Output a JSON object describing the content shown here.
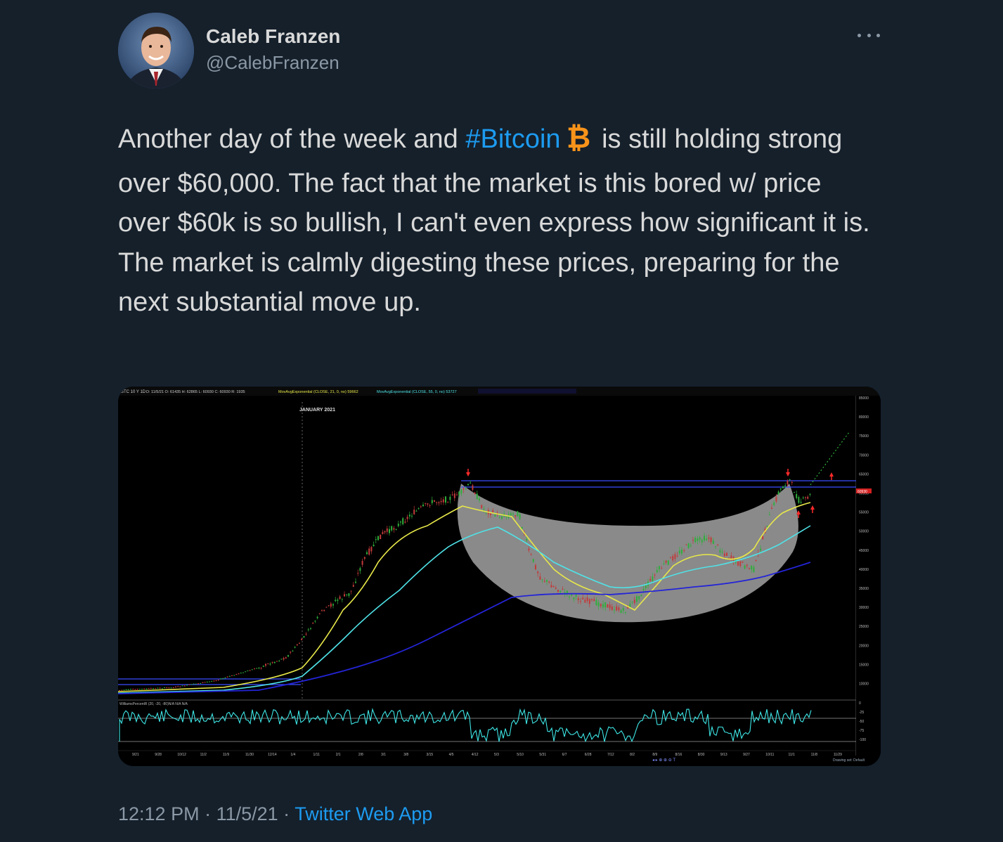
{
  "author": {
    "display_name": "Caleb Franzen",
    "handle": "@CalebFranzen"
  },
  "tweet": {
    "text_before_hashtag": "Another day of the week and ",
    "hashtag": "#Bitcoin",
    "text_after_hashtag": " is still holding strong over $60,000. The fact that the market is this bored w/ price over $60k is so bullish, I can't even express how significant it is. The market is calmly digesting these prices, preparing for the next substantial move up."
  },
  "footer": {
    "time": "12:12 PM",
    "separator": " · ",
    "date": "11/5/21",
    "app": "Twitter Web App"
  },
  "media": {
    "header_symbol": "BTC 10 Y 1D",
    "header_info": "D: 11/5/21  O: 61435  H: 62865  L: 60930  C: 60930  R: 1935",
    "ema21_label": "MovAvgExponential (CLOSE, 21, 0, no)  59662",
    "ema55_label": "MovAvgExponential (CLOSE, 55, 0, no)  53727",
    "annotation": "JANUARY 2021",
    "last_price": "60930",
    "price_ticks": [
      "85000",
      "80000",
      "75000",
      "70000",
      "65000",
      "60000",
      "55000",
      "50000",
      "45000",
      "40000",
      "35000",
      "30000",
      "25000",
      "20000",
      "15000",
      "10000"
    ],
    "date_ticks": [
      "9/21",
      "9/28",
      "10/12",
      "11/2",
      "11/9",
      "11/30",
      "12/14",
      "1/4",
      "1/11",
      "2/1",
      "2/8",
      "3/1",
      "3/8",
      "3/15",
      "4/5",
      "4/12",
      "5/3",
      "5/10",
      "5/31",
      "6/7",
      "6/28",
      "7/12",
      "8/2",
      "8/9",
      "8/16",
      "8/30",
      "9/13",
      "9/27",
      "10/11",
      "11/1",
      "11/8",
      "11/29"
    ],
    "wr_label": "WilliamsPercentR (20, -20, -80)N/A N/A N/A",
    "wr_ticks": [
      "0",
      "-25",
      "-50",
      "-75",
      "-100"
    ],
    "drawing_set": "Drawing set: Default",
    "colors": {
      "ema21": "#e8e84a",
      "ema55": "#4fe3e8",
      "ema200": "#2424d8",
      "support_lines": "#3b4dff",
      "bowl": "#a8a8a8",
      "candle_up": "#2fae3c",
      "candle_down": "#c23b3b",
      "wr_line": "#3ee6e6",
      "arrow": "#ff2a2a"
    }
  }
}
